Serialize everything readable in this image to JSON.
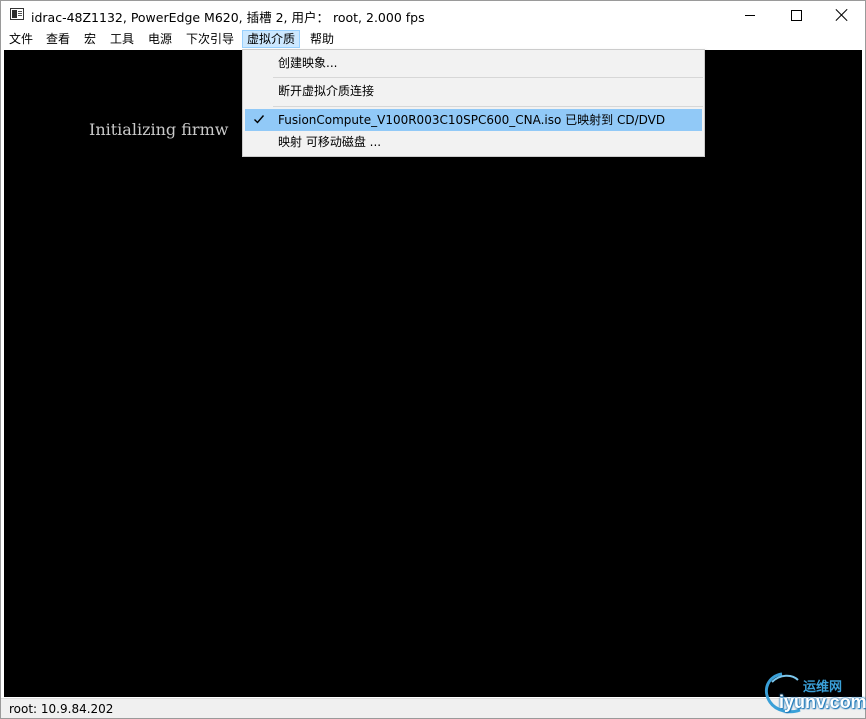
{
  "window": {
    "title": "idrac-48Z1132, PowerEdge M620,  插槽 2, 用户： root, 2.000 fps"
  },
  "icons": {
    "app": "console-window-icon",
    "minimize": "minimize-icon",
    "maximize": "maximize-icon",
    "close": "close-icon",
    "check": "checkmark-icon"
  },
  "menubar": {
    "items": [
      {
        "label": "文件"
      },
      {
        "label": "查看"
      },
      {
        "label": "宏"
      },
      {
        "label": "工具"
      },
      {
        "label": "电源"
      },
      {
        "label": "下次引导"
      },
      {
        "label": "虚拟介质"
      },
      {
        "label": "帮助"
      }
    ],
    "open_menu": "虚拟介质"
  },
  "dropdown": {
    "items": [
      {
        "label": "创建映象...",
        "checked": false
      },
      {
        "label": "断开虚拟介质连接",
        "checked": false
      },
      {
        "label": "FusionCompute_V100R003C10SPC600_CNA.iso 已映射到 CD/DVD",
        "checked": true
      },
      {
        "label": "映射 可移动磁盘 ...",
        "checked": false
      }
    ]
  },
  "console": {
    "text": "Initializing firmw"
  },
  "statusbar": {
    "text": "root: 10.9.84.202"
  },
  "watermark": {
    "cn": "运维网",
    "en": "iyunv.com"
  },
  "colors": {
    "console_bg": "#000000",
    "console_text": "#c9c9c9",
    "menu_open_bg": "#cce8ff",
    "dropdown_bg": "#f2f2f2",
    "highlight": "#91c9f7",
    "watermark": "#3aa0d8"
  }
}
